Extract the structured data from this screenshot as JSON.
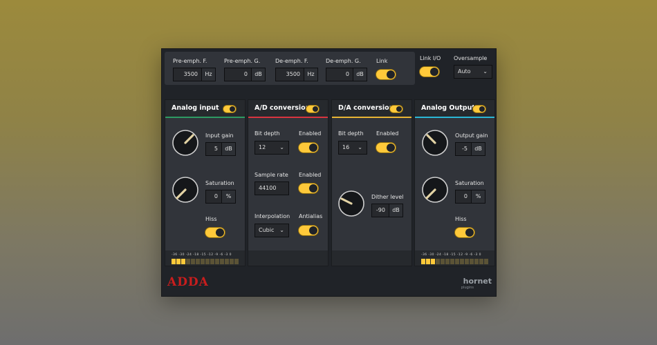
{
  "top": {
    "pre_freq": {
      "label": "Pre-emph. F.",
      "value": "3500",
      "unit": "Hz"
    },
    "pre_gain": {
      "label": "Pre-emph. G.",
      "value": "0",
      "unit": "dB"
    },
    "de_freq": {
      "label": "De-emph. F.",
      "value": "3500",
      "unit": "Hz"
    },
    "de_gain": {
      "label": "De-emph. G.",
      "value": "0",
      "unit": "dB"
    },
    "link_label": "Link",
    "link_io_label": "Link I/O",
    "oversample_label": "Oversample",
    "oversample_value": "Auto"
  },
  "analog_input": {
    "title": "Analog input",
    "accent": "#2d9a63",
    "input_gain": {
      "label": "Input gain",
      "value": "5",
      "unit": "dB"
    },
    "saturation": {
      "label": "Saturation",
      "value": "0",
      "unit": "%"
    },
    "hiss_label": "Hiss",
    "meter_scale": "-36 -30 -24 -18 -15 -12  -9   -6   -3   0",
    "meter_lit": 3
  },
  "ad": {
    "title": "A/D conversion",
    "accent": "#d9343f",
    "bit_depth_label": "Bit depth",
    "bit_depth_value": "12",
    "enabled1_label": "Enabled",
    "sample_rate_label": "Sample rate",
    "sample_rate_value": "44100",
    "enabled2_label": "Enabled",
    "interp_label": "Interpolation",
    "interp_value": "Cubic",
    "antialias_label": "Antialias"
  },
  "da": {
    "title": "D/A conversion",
    "accent": "#e8b534",
    "bit_depth_label": "Bit depth",
    "bit_depth_value": "16",
    "enabled_label": "Enabled",
    "dither": {
      "label": "Dither level",
      "value": "-90",
      "unit": "dB"
    }
  },
  "analog_output": {
    "title": "Analog Output",
    "accent": "#2ab7d6",
    "output_gain": {
      "label": "Output gain",
      "value": "-5",
      "unit": "dB"
    },
    "saturation": {
      "label": "Saturation",
      "value": "0",
      "unit": "%"
    },
    "hiss_label": "Hiss",
    "meter_scale": "-36 -30 -24 -18 -15 -12  -9   -6   -3   0",
    "meter_lit": 3
  },
  "brand": "ADDA",
  "vendor": "hornet",
  "vendor_sub": "plugins"
}
